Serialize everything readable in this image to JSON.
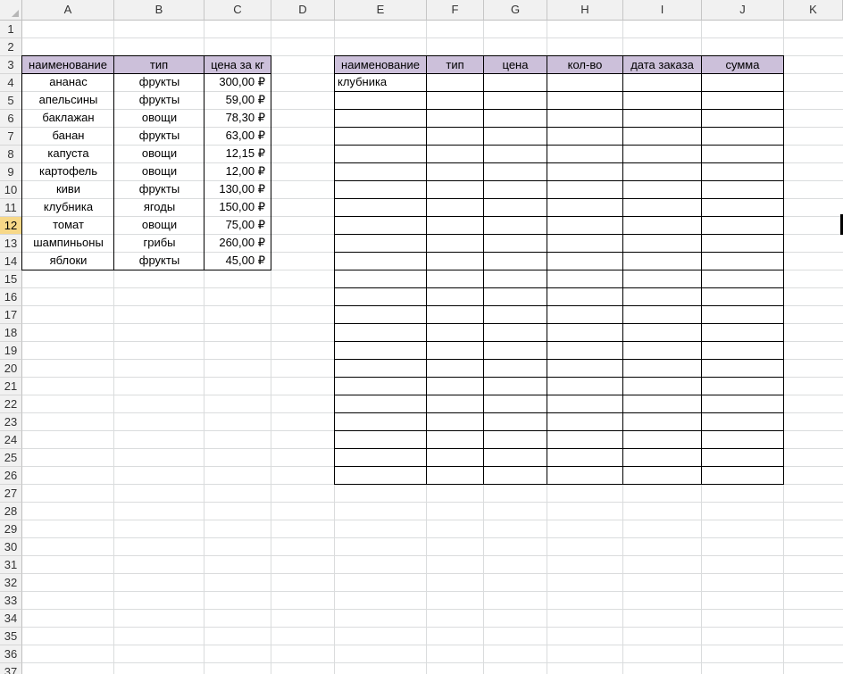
{
  "columns": [
    "A",
    "B",
    "C",
    "D",
    "E",
    "F",
    "G",
    "H",
    "I",
    "J",
    "K"
  ],
  "rows": [
    "1",
    "2",
    "3",
    "4",
    "5",
    "6",
    "7",
    "8",
    "9",
    "10",
    "11",
    "12",
    "13",
    "14",
    "15",
    "16",
    "17",
    "18",
    "19",
    "20",
    "21",
    "22",
    "23",
    "24",
    "25",
    "26",
    "27",
    "28",
    "29",
    "30",
    "31",
    "32",
    "33",
    "34",
    "35",
    "36",
    "37"
  ],
  "selected_row": "12",
  "colors": {
    "header_fill": "#ccc0da",
    "selected_row_header": "#f7d888",
    "gridline": "#dadcdd"
  },
  "price_table": {
    "headers": [
      "наименование",
      "тип",
      "цена за кг"
    ],
    "rows": [
      [
        "ананас",
        "фрукты",
        "300,00 ₽"
      ],
      [
        "апельсины",
        "фрукты",
        "59,00 ₽"
      ],
      [
        "баклажан",
        "овощи",
        "78,30 ₽"
      ],
      [
        "банан",
        "фрукты",
        "63,00 ₽"
      ],
      [
        "капуста",
        "овощи",
        "12,15 ₽"
      ],
      [
        "картофель",
        "овощи",
        "12,00 ₽"
      ],
      [
        "киви",
        "фрукты",
        "130,00 ₽"
      ],
      [
        "клубника",
        "ягоды",
        "150,00 ₽"
      ],
      [
        "томат",
        "овощи",
        "75,00 ₽"
      ],
      [
        "шампиньоны",
        "грибы",
        "260,00 ₽"
      ],
      [
        "яблоки",
        "фрукты",
        "45,00 ₽"
      ]
    ]
  },
  "order_table": {
    "headers": [
      "наименование",
      "тип",
      "цена",
      "кол-во",
      "дата заказа",
      "сумма"
    ],
    "first_value": "клубника",
    "row_count": 23
  }
}
